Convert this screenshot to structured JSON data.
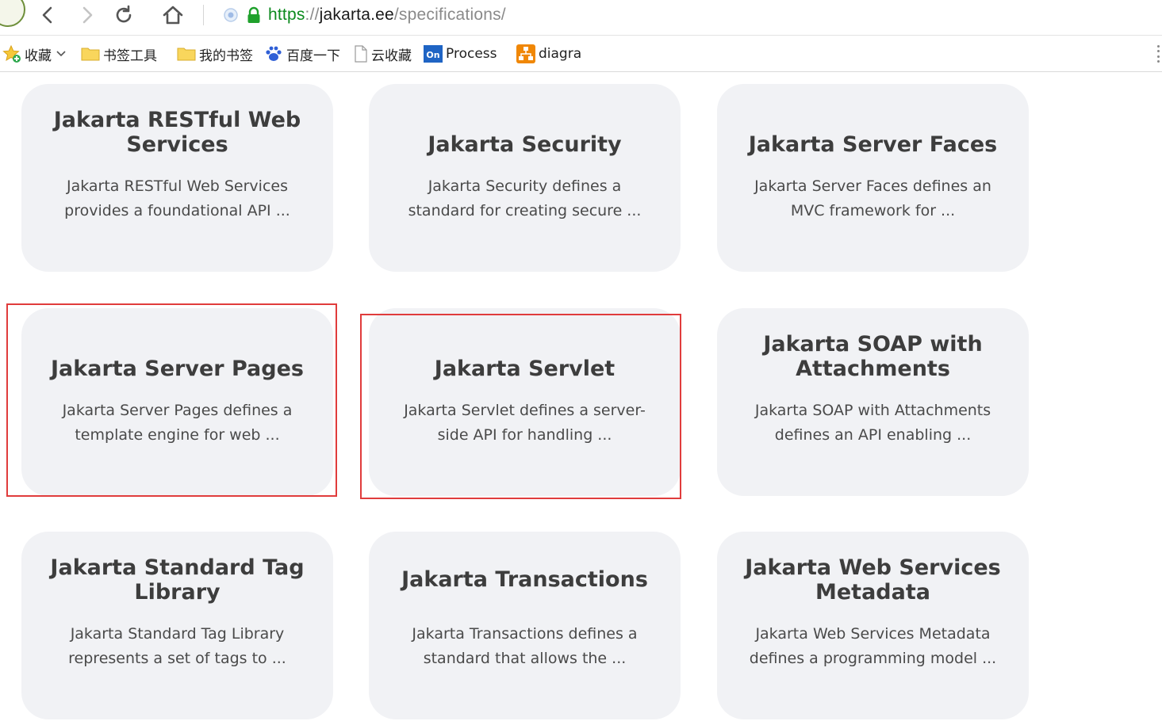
{
  "browser": {
    "url_scheme": "https",
    "url_separator": "://",
    "url_host": "jakarta.ee",
    "url_path": "/specifications/"
  },
  "bookmarks": [
    {
      "label": "收藏",
      "icon": "star-add-icon"
    },
    {
      "label": "书签工具",
      "icon": "folder-icon"
    },
    {
      "label": "我的书签",
      "icon": "folder-icon"
    },
    {
      "label": "百度一下",
      "icon": "baidu-paw-icon"
    },
    {
      "label": "云收藏",
      "icon": "page-icon"
    },
    {
      "label": "Process",
      "icon": "processon-icon"
    },
    {
      "label": "diagra",
      "icon": "diagrams-icon"
    }
  ],
  "cards": [
    {
      "title": "Jakarta RESTful Web Services",
      "description": "Jakarta RESTful Web Services provides a foundational API ..."
    },
    {
      "title": "Jakarta Security",
      "description": "Jakarta Security defines a standard for creating secure ..."
    },
    {
      "title": "Jakarta Server Faces",
      "description": "Jakarta Server Faces defines an MVC framework for ..."
    },
    {
      "title": "Jakarta Server Pages",
      "description": "Jakarta Server Pages defines a template engine for web ..."
    },
    {
      "title": "Jakarta Servlet",
      "description": "Jakarta Servlet defines a server-side API for handling ..."
    },
    {
      "title": "Jakarta SOAP with Attachments",
      "description": "Jakarta SOAP with Attachments defines an API enabling ..."
    },
    {
      "title": "Jakarta Standard Tag Library",
      "description": "Jakarta Standard Tag Library represents a set of tags to ..."
    },
    {
      "title": "Jakarta Transactions",
      "description": "Jakarta Transactions defines a standard that allows the ..."
    },
    {
      "title": "Jakarta Web Services Metadata",
      "description": "Jakarta Web Services Metadata defines a programming model ..."
    }
  ],
  "colors": {
    "card_background": "#f1f2f5",
    "highlight_border": "#e03c3c",
    "url_scheme": "#0c8a1e"
  }
}
